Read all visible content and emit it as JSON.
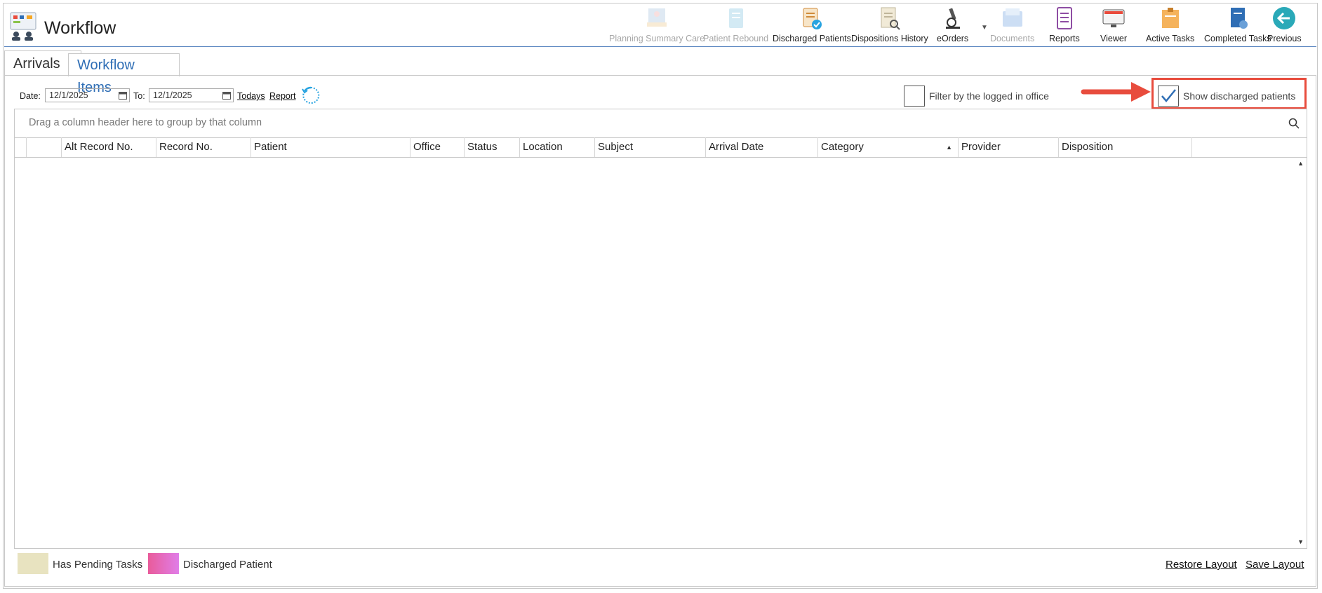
{
  "app": {
    "title": "Workflow"
  },
  "toolbar": {
    "planning_summary_care": "Planning Summary Care",
    "patient_rebound": "Patient Rebound",
    "discharged_patients": "Discharged Patients",
    "dispositions_history": "Dispositions History",
    "eorders": "eOrders",
    "documents": "Documents",
    "reports": "Reports",
    "viewer": "Viewer",
    "active_tasks": "Active Tasks",
    "completed_tasks": "Completed Tasks",
    "previous": "Previous"
  },
  "tabs": {
    "arrivals": "Arrivals",
    "workflow_items": "Workflow Items"
  },
  "filter": {
    "date_label": "Date:",
    "date_value": "12/1/2025",
    "to_label": "To:",
    "to_value": "12/1/2025",
    "todays_link": "Todays",
    "report_link": "Report",
    "filter_office_label": "Filter by the logged in office",
    "filter_office_checked": false,
    "show_discharged_label": "Show discharged patients",
    "show_discharged_checked": true
  },
  "grid": {
    "group_hint": "Drag a column header here to group by that column",
    "columns": [
      "Alt Record No.",
      "Record No.",
      "Patient",
      "Office",
      "Status",
      "Location",
      "Subject",
      "Arrival Date",
      "Category",
      "Provider",
      "Disposition"
    ],
    "sorted_column": "Category",
    "sort_direction": "ascending",
    "rows": []
  },
  "legend": {
    "pending_label": "Has Pending Tasks",
    "pending_color": "#e8e3c0",
    "discharged_label": "Discharged Patient",
    "discharged_color_start": "#e95b9a",
    "discharged_color_end": "#e07ee8"
  },
  "footer": {
    "restore_layout": "Restore Layout",
    "save_layout": "Save Layout"
  },
  "colors": {
    "accent": "#2f6eb5",
    "highlight": "#e84c3d"
  }
}
